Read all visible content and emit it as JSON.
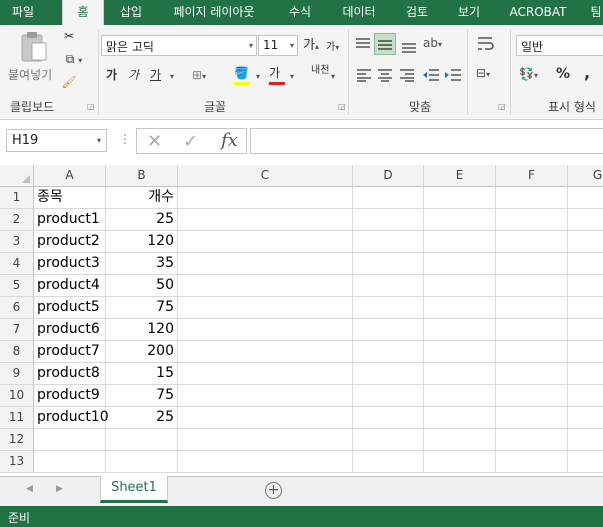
{
  "tabs": [
    "파일",
    "홈",
    "삽입",
    "페이지 레이아웃",
    "수식",
    "데이터",
    "검토",
    "보기",
    "ACROBAT",
    "팀"
  ],
  "ribbon": {
    "clipboard": {
      "paste_label": "붙여넣기",
      "group_label": "클립보드"
    },
    "font": {
      "font_name": "맑은 고딕",
      "font_size": "11",
      "grow_label": "가",
      "shrink_label": "가",
      "bold": "가",
      "italic": "가",
      "underline": "가",
      "font_color_label": "가",
      "phonetic_label": "내천",
      "group_label": "글꼴"
    },
    "alignment": {
      "group_label": "맞춤"
    },
    "number": {
      "format": "일반",
      "percent": "%",
      "comma": ",",
      "group_label": "표시 형식"
    }
  },
  "formula_bar": {
    "name_box": "H19",
    "fx": "fx",
    "value": ""
  },
  "columns": [
    "A",
    "B",
    "C",
    "D",
    "E",
    "F",
    "G"
  ],
  "rows": [
    {
      "num": "1",
      "a": "종목",
      "b": "개수"
    },
    {
      "num": "2",
      "a": "product1",
      "b": "25"
    },
    {
      "num": "3",
      "a": "product2",
      "b": "120"
    },
    {
      "num": "4",
      "a": "product3",
      "b": "35"
    },
    {
      "num": "5",
      "a": "product4",
      "b": "50"
    },
    {
      "num": "6",
      "a": "product5",
      "b": "75"
    },
    {
      "num": "7",
      "a": "product6",
      "b": "120"
    },
    {
      "num": "8",
      "a": "product7",
      "b": "200"
    },
    {
      "num": "9",
      "a": "product8",
      "b": "15"
    },
    {
      "num": "10",
      "a": "product9",
      "b": "75"
    },
    {
      "num": "11",
      "a": "product10",
      "b": "25"
    },
    {
      "num": "12",
      "a": "",
      "b": ""
    },
    {
      "num": "13",
      "a": "",
      "b": ""
    }
  ],
  "sheets": {
    "active": "Sheet1",
    "add_label": "+"
  },
  "status": {
    "text": "준비"
  },
  "colors": {
    "accent": "#217346"
  }
}
